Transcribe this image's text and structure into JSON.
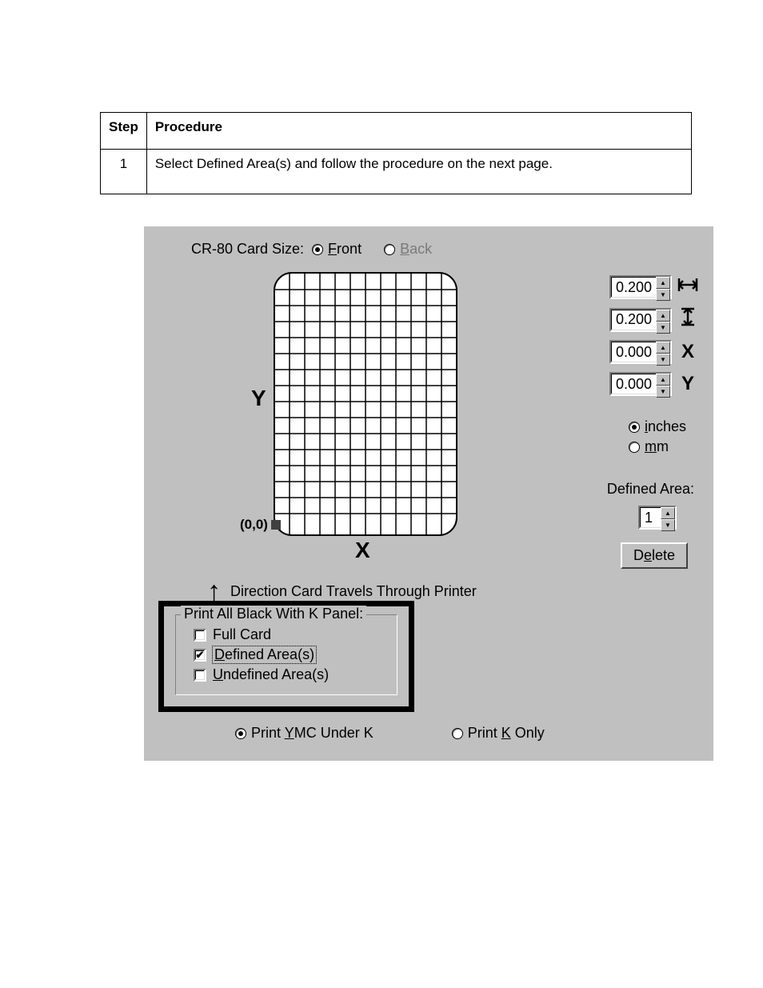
{
  "doc_table": {
    "step_header": "Step",
    "proc_header": "Procedure",
    "step_value": "1",
    "proc_value": "Select Defined Area(s) and follow the procedure on the next page."
  },
  "dialog": {
    "card_size_label": "CR-80 Card Size:",
    "front_label": "Front",
    "back_label": "Back",
    "front_selected": true,
    "origin_label": "(0,0)",
    "y_axis": "Y",
    "x_axis": "X",
    "direction_text": "Direction Card Travels Through Printer",
    "spinners": {
      "w": "0.200",
      "h": "0.200",
      "x": "0.000",
      "y": "0.000"
    },
    "dim_labels": {
      "w": "↔",
      "h": "↕",
      "x": "X",
      "y": "Y"
    },
    "units": {
      "inches": "inches",
      "mm": "mm",
      "inches_selected": true
    },
    "defined_area_label": "Defined Area:",
    "defined_area_value": "1",
    "delete_label": "Delete",
    "group_legend": "Print All Black With K Panel:",
    "checks": {
      "full_card": {
        "label": "Full Card",
        "checked": false
      },
      "defined": {
        "label": "Defined Area(s)",
        "checked": true
      },
      "undefined": {
        "label": "Undefined Area(s)",
        "checked": false
      }
    },
    "bottom": {
      "ymc": "Print YMC Under K",
      "konly": "Print K Only",
      "ymc_selected": true
    }
  }
}
